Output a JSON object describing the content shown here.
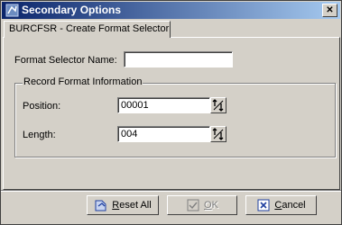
{
  "window": {
    "title": "Secondary Options",
    "close_glyph": "✕"
  },
  "tab": {
    "label": "BURCFSR - Create Format Selector"
  },
  "form": {
    "format_selector_name_label": "Format Selector Name:",
    "format_selector_name_value": "",
    "group_title": "Record Format Information",
    "position_label": "Position:",
    "position_value": "00001",
    "length_label": "Length:",
    "length_value": "004"
  },
  "buttons": {
    "reset_all": "Reset All",
    "ok": "OK",
    "cancel": "Cancel"
  },
  "colors": {
    "titlebar_start": "#0a246a",
    "titlebar_end": "#a6caf0",
    "face": "#d4d0c8"
  }
}
